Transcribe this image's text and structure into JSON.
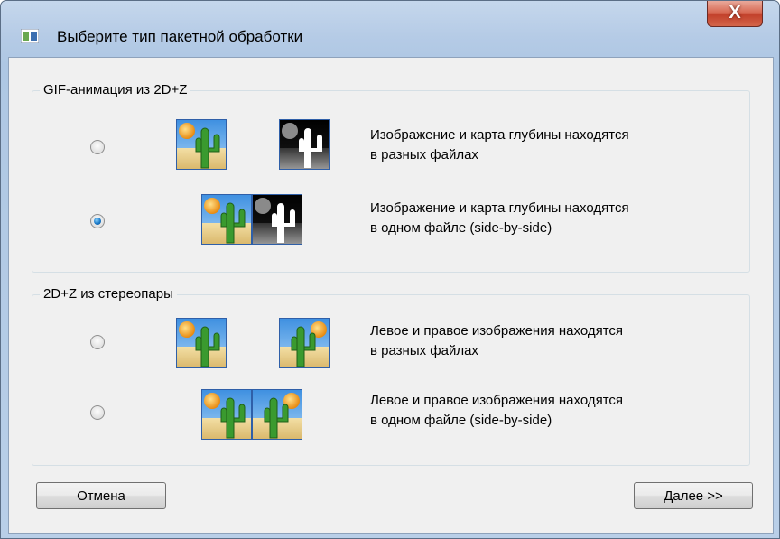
{
  "window": {
    "title": "Выберите тип пакетной обработки",
    "close_glyph": "X"
  },
  "groups": [
    {
      "title": "GIF-анимация из 2D+Z",
      "options": [
        {
          "line1": "Изображение и карта глубины находятся",
          "line2": "в разных файлах",
          "selected": false,
          "thumbs": [
            "cactus-image-icon",
            "depth-map-icon"
          ]
        },
        {
          "line1": "Изображение и карта глубины находятся",
          "line2": "в одном файле (side-by-side)",
          "selected": true,
          "thumbs": [
            "cactus-image-icon",
            "depth-map-icon"
          ]
        }
      ]
    },
    {
      "title": "2D+Z из стереопары",
      "options": [
        {
          "line1": "Левое и правое изображения находятся",
          "line2": "в разных файлах",
          "selected": false,
          "thumbs": [
            "cactus-left-icon",
            "cactus-right-icon"
          ]
        },
        {
          "line1": "Левое и правое изображения находятся",
          "line2": "в одном файле (side-by-side)",
          "selected": false,
          "thumbs": [
            "cactus-left-icon",
            "cactus-right-icon"
          ]
        }
      ]
    }
  ],
  "buttons": {
    "cancel": "Отмена",
    "next": "Далее >>"
  }
}
